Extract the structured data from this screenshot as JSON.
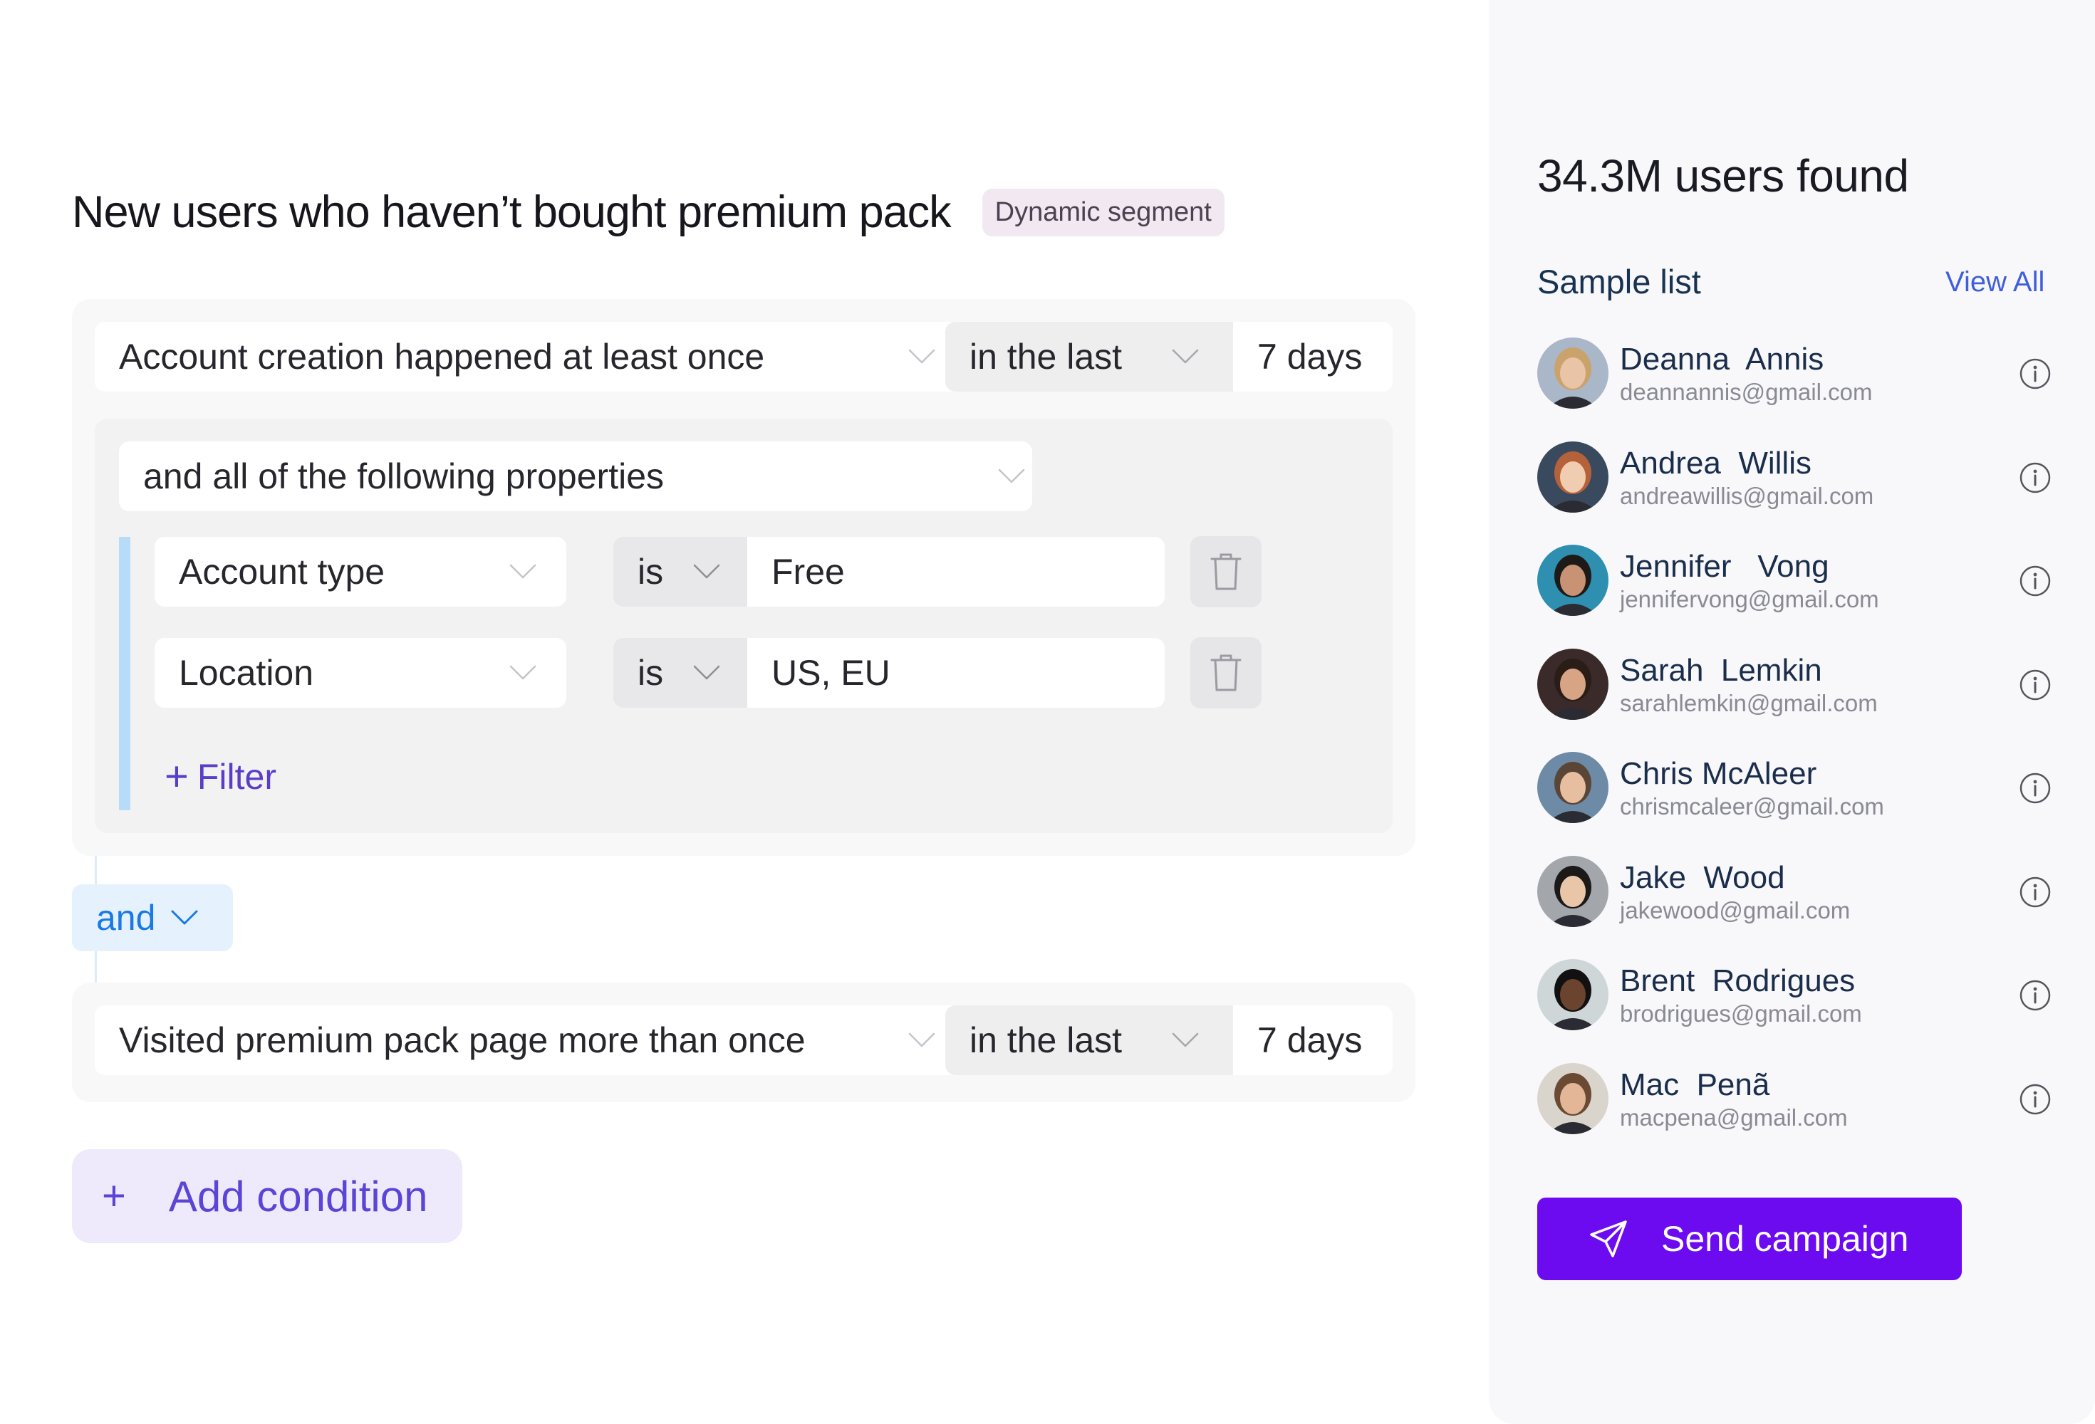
{
  "segment": {
    "title": "New users who haven’t bought premium pack",
    "badge": "Dynamic segment"
  },
  "conditions": [
    {
      "event": "Account creation happened at least once",
      "range": "in the last",
      "value": "7 days",
      "properties": {
        "label": "and all of the following properties",
        "filters": [
          {
            "property": "Account type",
            "operator": "is",
            "value": "Free"
          },
          {
            "property": "Location",
            "operator": "is",
            "value": "US, EU"
          }
        ],
        "add_filter": "Filter"
      }
    },
    {
      "event": "Visited premium pack page more than once",
      "range": "in the last",
      "value": "7 days"
    }
  ],
  "joiner": "and",
  "add_condition": "Add condition",
  "results": {
    "count_text": "34.3M users found",
    "sample_title": "Sample list",
    "view_all": "View All",
    "users": [
      {
        "name": "Deanna  Annis",
        "email": "deannannis@gmail.com"
      },
      {
        "name": "Andrea  Willis",
        "email": "andreawillis@gmail.com"
      },
      {
        "name": "Jennifer   Vong",
        "email": "jennifervong@gmail.com"
      },
      {
        "name": "Sarah  Lemkin",
        "email": "sarahlemkin@gmail.com"
      },
      {
        "name": "Chris McAleer",
        "email": "chrismcaleer@gmail.com"
      },
      {
        "name": "Jake  Wood",
        "email": "jakewood@gmail.com"
      },
      {
        "name": "Brent  Rodrigues",
        "email": "brodrigues@gmail.com"
      },
      {
        "name": "Mac  Penã",
        "email": "macpena@gmail.com"
      }
    ],
    "send_button": "Send campaign"
  },
  "colors": {
    "accent": "#6c0bf0",
    "link": "#3f5fdc",
    "joiner": "#1979e6",
    "filter": "#5a3ec8"
  },
  "icons": [
    "chevron-down-icon",
    "trash-icon",
    "plus-icon",
    "info-icon",
    "paper-plane-icon"
  ]
}
